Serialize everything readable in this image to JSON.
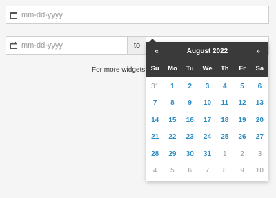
{
  "single": {
    "placeholder": "mm-dd-yyyy"
  },
  "range": {
    "start_placeholder": "mm-dd-yyyy",
    "separator": "to",
    "end_placeholder": ""
  },
  "note": "For more widgets, v",
  "calendar": {
    "prev": "«",
    "next": "»",
    "title": "August 2022",
    "weekdays": [
      "Su",
      "Mo",
      "Tu",
      "We",
      "Th",
      "Fr",
      "Sa"
    ],
    "weeks": [
      [
        {
          "d": "31",
          "m": "prev"
        },
        {
          "d": "1",
          "m": "cur"
        },
        {
          "d": "2",
          "m": "cur"
        },
        {
          "d": "3",
          "m": "cur"
        },
        {
          "d": "4",
          "m": "cur"
        },
        {
          "d": "5",
          "m": "cur"
        },
        {
          "d": "6",
          "m": "cur"
        }
      ],
      [
        {
          "d": "7",
          "m": "cur"
        },
        {
          "d": "8",
          "m": "cur"
        },
        {
          "d": "9",
          "m": "cur"
        },
        {
          "d": "10",
          "m": "cur"
        },
        {
          "d": "11",
          "m": "cur"
        },
        {
          "d": "12",
          "m": "cur"
        },
        {
          "d": "13",
          "m": "cur"
        }
      ],
      [
        {
          "d": "14",
          "m": "cur"
        },
        {
          "d": "15",
          "m": "cur"
        },
        {
          "d": "16",
          "m": "cur"
        },
        {
          "d": "17",
          "m": "cur"
        },
        {
          "d": "18",
          "m": "cur"
        },
        {
          "d": "19",
          "m": "cur"
        },
        {
          "d": "20",
          "m": "cur"
        }
      ],
      [
        {
          "d": "21",
          "m": "cur"
        },
        {
          "d": "22",
          "m": "cur"
        },
        {
          "d": "23",
          "m": "cur"
        },
        {
          "d": "24",
          "m": "cur"
        },
        {
          "d": "25",
          "m": "cur"
        },
        {
          "d": "26",
          "m": "cur"
        },
        {
          "d": "27",
          "m": "cur"
        }
      ],
      [
        {
          "d": "28",
          "m": "cur"
        },
        {
          "d": "29",
          "m": "cur"
        },
        {
          "d": "30",
          "m": "cur"
        },
        {
          "d": "31",
          "m": "cur"
        },
        {
          "d": "1",
          "m": "next"
        },
        {
          "d": "2",
          "m": "next"
        },
        {
          "d": "3",
          "m": "next"
        }
      ],
      [
        {
          "d": "4",
          "m": "next"
        },
        {
          "d": "5",
          "m": "next"
        },
        {
          "d": "6",
          "m": "next"
        },
        {
          "d": "7",
          "m": "next"
        },
        {
          "d": "8",
          "m": "next"
        },
        {
          "d": "9",
          "m": "next"
        },
        {
          "d": "10",
          "m": "next"
        }
      ]
    ]
  },
  "colors": {
    "header_bg": "#3a3a3a",
    "day_current": "#2b8cc4",
    "day_other": "#9a9a9a"
  },
  "icons": {
    "field_icon": "calendar-icon"
  }
}
